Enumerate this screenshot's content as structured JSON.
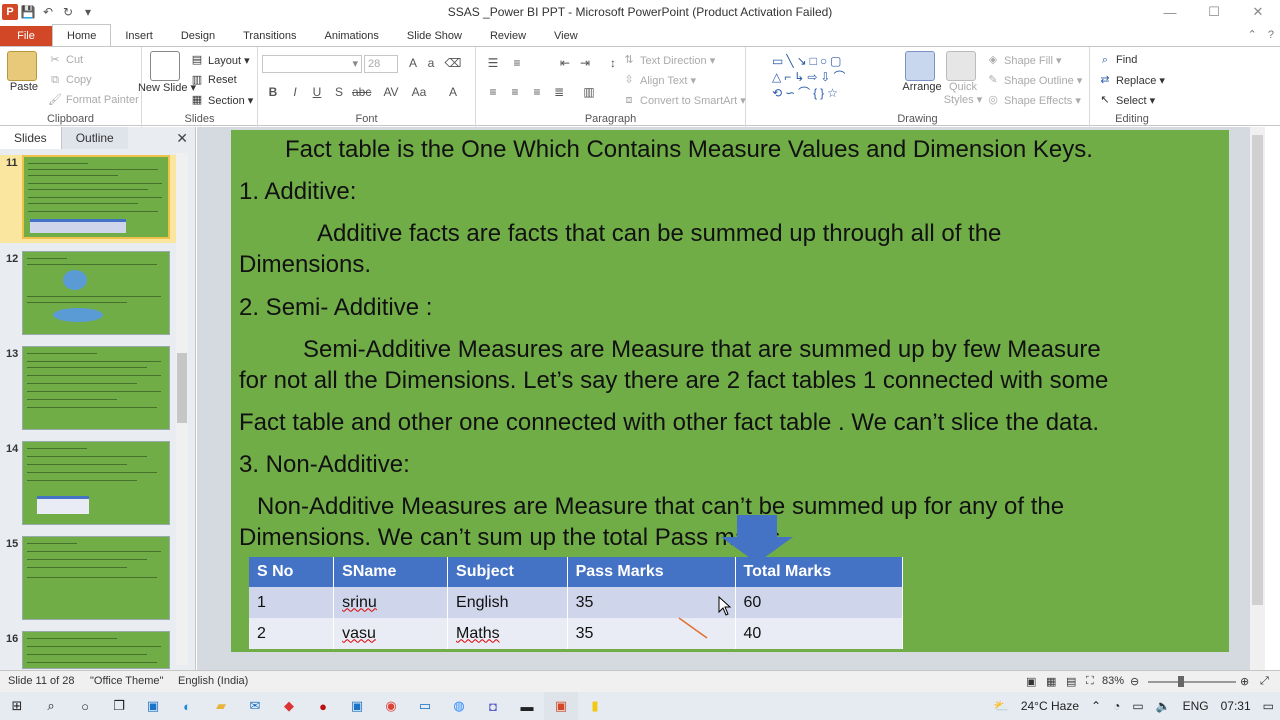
{
  "window": {
    "title": "SSAS _Power BI PPT  -  Microsoft PowerPoint (Product Activation Failed)",
    "controls": [
      "—",
      "☐",
      "✕"
    ]
  },
  "tabs": [
    "File",
    "Home",
    "Insert",
    "Design",
    "Transitions",
    "Animations",
    "Slide Show",
    "Review",
    "View"
  ],
  "ribbon": {
    "clipboard": {
      "label": "Clipboard",
      "paste": "Paste",
      "cut": "Cut",
      "copy": "Copy",
      "format_painter": "Format Painter"
    },
    "slides": {
      "label": "Slides",
      "new_slide": "New Slide ▾",
      "layout": "Layout ▾",
      "reset": "Reset",
      "section": "Section ▾"
    },
    "font": {
      "label": "Font",
      "font_name": "",
      "font_size": "28"
    },
    "paragraph": {
      "label": "Paragraph",
      "text_direction": "Text Direction ▾",
      "align_text": "Align Text ▾",
      "convert_smartart": "Convert to SmartArt ▾"
    },
    "drawing": {
      "label": "Drawing",
      "arrange": "Arrange",
      "quick_styles": "Quick Styles ▾",
      "shape_fill": "Shape Fill ▾",
      "shape_outline": "Shape Outline ▾",
      "shape_effects": "Shape Effects ▾"
    },
    "editing": {
      "label": "Editing",
      "find": "Find",
      "replace": "Replace ▾",
      "select": "Select ▾"
    }
  },
  "panel": {
    "tabs": [
      "Slides",
      "Outline"
    ],
    "close": "✕",
    "slide_numbers": [
      "11",
      "12",
      "13",
      "14",
      "15",
      "16"
    ],
    "selected": "11"
  },
  "slide": {
    "line1": "Fact table is the One Which Contains Measure Values and Dimension Keys.",
    "h1": "1.   Additive:",
    "p1a": "Additive facts are facts that can be summed up through all of the",
    "p1b": "Dimensions.",
    "h2": "2. Semi- Additive :",
    "p2a": "Semi-Additive Measures are Measure that are summed up by few Measure",
    "p2b": "for not all the Dimensions. Let’s say there are 2 fact tables 1 connected with some",
    "p2c": "Fact table and other one connected with other fact table . We can’t slice the data.",
    "h3": "3. Non-Additive:",
    "p3a": "Non-Additive Measures are Measure that can’t be summed up for any of the",
    "p3b": "Dimensions.     We can’t sum up the total           Pass marks",
    "table": {
      "headers": [
        "S No",
        "SName",
        "Subject",
        "Pass Marks",
        "Total Marks"
      ],
      "rows": [
        [
          "1",
          "srinu",
          "English",
          "35",
          "60"
        ],
        [
          "2",
          "vasu",
          "Maths",
          "35",
          "40"
        ]
      ]
    }
  },
  "status": {
    "slide_info": "Slide 11 of 28",
    "theme": "\"Office Theme\"",
    "language": "English (India)",
    "zoom": "83%"
  },
  "taskbar": {
    "weather": "24°C  Haze",
    "lang": "ENG",
    "time": "07:31"
  },
  "colors": {
    "slide_bg": "#70ad47",
    "table_header": "#4472c4",
    "file_tab": "#d24726",
    "arrow": "#4472c4"
  }
}
